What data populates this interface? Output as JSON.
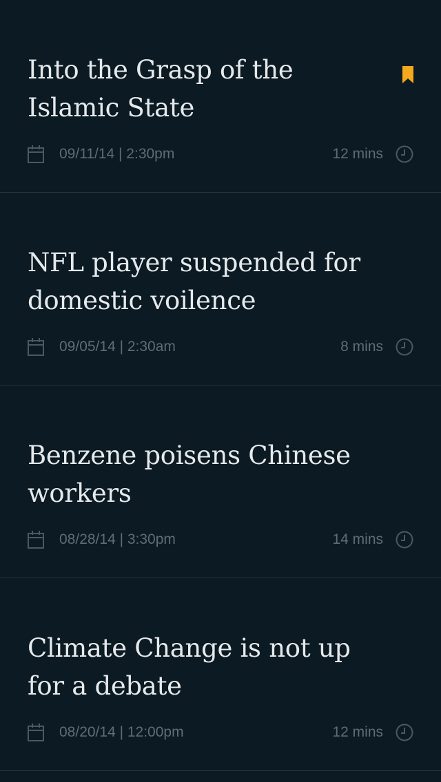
{
  "colors": {
    "background": "#0b1a23",
    "title_text": "#e6e9eb",
    "meta_text": "#5f6d75",
    "divider": "#26343d",
    "bookmark_accent": "#f4a81d"
  },
  "articles": [
    {
      "title": "Into the Grasp of the Islamic State",
      "date": "09/11/14 | 2:30pm",
      "duration": "12 mins",
      "bookmarked": true
    },
    {
      "title": "NFL player suspended for domestic voilence",
      "date": "09/05/14 | 2:30am",
      "duration": "8 mins",
      "bookmarked": false
    },
    {
      "title": "Benzene poisens Chinese workers",
      "date": "08/28/14 | 3:30pm",
      "duration": "14 mins",
      "bookmarked": false
    },
    {
      "title": "Climate Change is not up for a debate",
      "date": "08/20/14 | 12:00pm",
      "duration": "12 mins",
      "bookmarked": false
    }
  ],
  "icons": {
    "calendar": "calendar-icon",
    "clock": "clock-icon",
    "bookmark": "bookmark-icon"
  }
}
